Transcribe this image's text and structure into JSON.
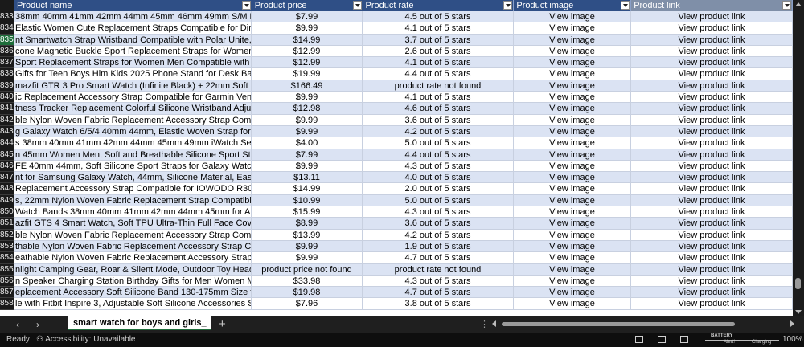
{
  "columns": {
    "name": "Product name",
    "price": "Product price",
    "rate": "Product rate",
    "image": "Product image",
    "link": "Product link"
  },
  "rows": [
    {
      "n": "833",
      "name": "38mm 40mm 41mm 42mm 44mm 45mm 46mm 49mm S/M M/L iWa",
      "price": "$7.99",
      "rate": "4.5 out of 5 stars",
      "image": "View image",
      "link": "View product link"
    },
    {
      "n": "834",
      "name": "Elastic Women Cute Replacement Straps Compatible for Dirrelo G",
      "price": "$9.99",
      "rate": "4.1 out of 5 stars",
      "image": "View image",
      "link": "View product link"
    },
    {
      "n": "835",
      "name": "nt Smartwatch Strap Wristband Compatible with Polar Unite, Ignite",
      "price": "$14.99",
      "rate": "3.7 out of 5 stars",
      "image": "View image",
      "link": "View product link"
    },
    {
      "n": "836",
      "name": "cone Magnetic Buckle Sport Replacement Straps for Women Men",
      "price": "$12.99",
      "rate": "2.6 out of 5 stars",
      "image": "View image",
      "link": "View product link"
    },
    {
      "n": "837",
      "name": "Sport Replacement Straps for Women Men Compatible with COR",
      "price": "$12.99",
      "rate": "4.1 out of 5 stars",
      "image": "View image",
      "link": "View product link"
    },
    {
      "n": "838",
      "name": "Gifts for Teen Boys Him Kids 2025 Phone Stand for Desk Back to Scl",
      "price": "$19.99",
      "rate": "4.4 out of 5 stars",
      "image": "View image",
      "link": "View product link"
    },
    {
      "n": "839",
      "name": "mazfit GTR 3 Pro Smart Watch (Infinite Black) + 22mm Soft Silicone",
      "price": "$166.49",
      "rate": "product rate not found",
      "image": "View image",
      "link": "View product link"
    },
    {
      "n": "840",
      "name": "ic Replacement Accessory Strap Compatible for Garmin Venu Sq S",
      "price": "$9.99",
      "rate": "4.1 out of 5 stars",
      "image": "View image",
      "link": "View product link"
    },
    {
      "n": "841",
      "name": "tness Tracker Replacement Colorful Silicone Wristband Adjustable",
      "price": "$12.98",
      "rate": "4.6 out of 5 stars",
      "image": "View image",
      "link": "View product link"
    },
    {
      "n": "842",
      "name": "ble Nylon Woven Fabric Replacement Accessory Strap Compatible",
      "price": "$9.99",
      "rate": "3.6 out of 5 stars",
      "image": "View image",
      "link": "View product link"
    },
    {
      "n": "843",
      "name": "g Galaxy Watch 6/5/4 40mm 44mm, Elastic Woven Strap for Galaxy",
      "price": "$9.99",
      "rate": "4.2 out of 5 stars",
      "image": "View image",
      "link": "View product link"
    },
    {
      "n": "844",
      "name": "s 38mm 40mm 41mm 42mm 44mm 45mm 49mm iWatch Series 9 8 7",
      "price": "$4.00",
      "rate": "5.0 out of 5 stars",
      "image": "View image",
      "link": "View product link"
    },
    {
      "n": "845",
      "name": "n 45mm Women Men, Soft and Breathable Silicone Sport Strap Rep",
      "price": "$7.99",
      "rate": "4.4 out of 5 stars",
      "image": "View image",
      "link": "View product link"
    },
    {
      "n": "846",
      "name": "FE 40mm 44mm, Soft Silicone Sport Straps for Galaxy Watch 5 Pro",
      "price": "$9.99",
      "rate": "4.3 out of 5 stars",
      "image": "View image",
      "link": "View product link"
    },
    {
      "n": "847",
      "name": "nt for Samsung Galaxy Watch, 44mm, Silicone Material, Easy Install",
      "price": "$13.11",
      "rate": "4.0 out of 5 stars",
      "image": "View image",
      "link": "View product link"
    },
    {
      "n": "848",
      "name": "Replacement Accessory Strap Compatible for IOWODO R30 Pro, R5",
      "price": "$14.99",
      "rate": "2.0 out of 5 stars",
      "image": "View image",
      "link": "View product link"
    },
    {
      "n": "849",
      "name": "s, 22mm Nylon Woven Fabric Replacement Strap Compatible for TO",
      "price": "$10.99",
      "rate": "5.0 out of 5 stars",
      "image": "View image",
      "link": "View product link"
    },
    {
      "n": "850",
      "name": "Watch Bands 38mm 40mm 41mm 42mm 44mm 45mm for Apple Wat",
      "price": "$15.99",
      "rate": "4.3 out of 5 stars",
      "image": "View image",
      "link": "View product link"
    },
    {
      "n": "851",
      "name": "azfit GTS 4 Smart Watch, Soft TPU Ultra-Thin Full Face Cover Replac",
      "price": "$8.99",
      "rate": "3.6 out of 5 stars",
      "image": "View image",
      "link": "View product link"
    },
    {
      "n": "852",
      "name": "ble Nylon Woven Fabric Replacement Accessory Strap Compatible",
      "price": "$13.99",
      "rate": "4.2 out of 5 stars",
      "image": "View image",
      "link": "View product link"
    },
    {
      "n": "853",
      "name": "thable Nylon Woven Fabric Replacement Accessory Strap Compatil",
      "price": "$9.99",
      "rate": "1.9 out of 5 stars",
      "image": "View image",
      "link": "View product link"
    },
    {
      "n": "854",
      "name": "eathable Nylon Woven Fabric Replacement Accessory Strap Comp",
      "price": "$9.99",
      "rate": "4.7 out of 5 stars",
      "image": "View image",
      "link": "View product link"
    },
    {
      "n": "855",
      "name": "nlight Camping Gear, Roar & Silent Mode, Outdoor Toy Head Lamp",
      "price": "product price not found",
      "rate": "product rate not found",
      "image": "View image",
      "link": "View product link"
    },
    {
      "n": "856",
      "name": "n Speaker Charging Station Birthday Gifts for Men Women Mother",
      "price": "$33.98",
      "rate": "4.3 out of 5 stars",
      "image": "View image",
      "link": "View product link"
    },
    {
      "n": "857",
      "name": "eplacement Accessory Soft Silicone Band 130-175mm Size for vivo",
      "price": "$19.98",
      "rate": "4.7 out of 5 stars",
      "image": "View image",
      "link": "View product link"
    },
    {
      "n": "858",
      "name": "le with Fitbit Inspire 3, Adjustable Soft Silicone Accessories Sport",
      "price": "$7.96",
      "rate": "3.8 out of 5 stars",
      "image": "View image",
      "link": "View product link"
    }
  ],
  "selected_row": "835",
  "sheet_tab": "smart watch for boys and girls_",
  "status": {
    "ready": "Ready",
    "accessibility": "Accessibility: Unavailable",
    "zoom": "100%"
  },
  "overlay": {
    "battery": "BATTERY",
    "alert": "Alert!",
    "charging": "Charging"
  },
  "colors": {
    "header_bg": "#2f4f86",
    "band_row": "#dbe3f3",
    "selected_rownum": "#1e6e3b"
  }
}
